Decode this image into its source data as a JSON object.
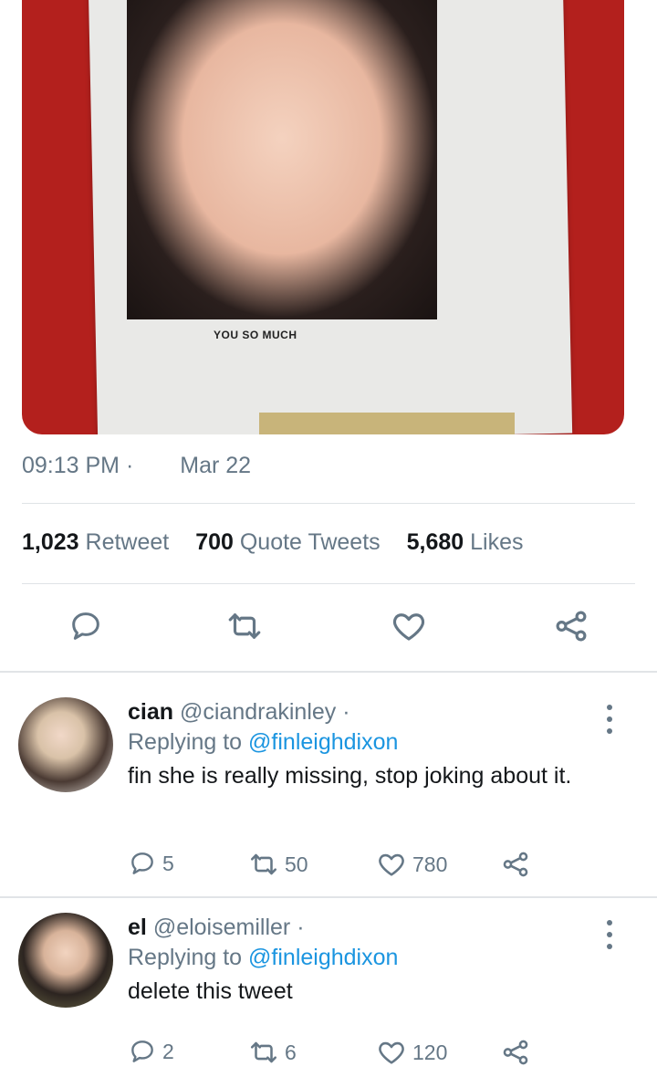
{
  "media": {
    "caption": "YOU SO MUCH"
  },
  "tweet": {
    "time": "09:13 PM",
    "separator": "·",
    "date": "Mar 22",
    "stats": {
      "retweets_count": "1,023",
      "retweets_label": "Retweet",
      "quotes_count": "700",
      "quotes_label": "Quote Tweets",
      "likes_count": "5,680",
      "likes_label": "Likes"
    }
  },
  "actions": {
    "reply_icon": "reply-icon",
    "retweet_icon": "retweet-icon",
    "like_icon": "heart-icon",
    "share_icon": "share-icon"
  },
  "replies": [
    {
      "name": "cian",
      "handle": "@ciandrakinley",
      "dot": "·",
      "replying_prefix": "Replying to",
      "replying_to": "@finleighdixon",
      "text": "fin she is really missing, stop joking about it.",
      "reply_count": "5",
      "retweet_count": "50",
      "like_count": "780"
    },
    {
      "name": "el",
      "handle": "@eloisemiller",
      "dot": "·",
      "replying_prefix": "Replying to",
      "replying_to": "@finleighdixon",
      "text": "delete this tweet",
      "reply_count": "2",
      "retweet_count": "6",
      "like_count": "120"
    }
  ],
  "colors": {
    "text_primary": "#14171a",
    "text_secondary": "#657786",
    "link": "#1b95e0",
    "divider": "#dfe3e6"
  }
}
